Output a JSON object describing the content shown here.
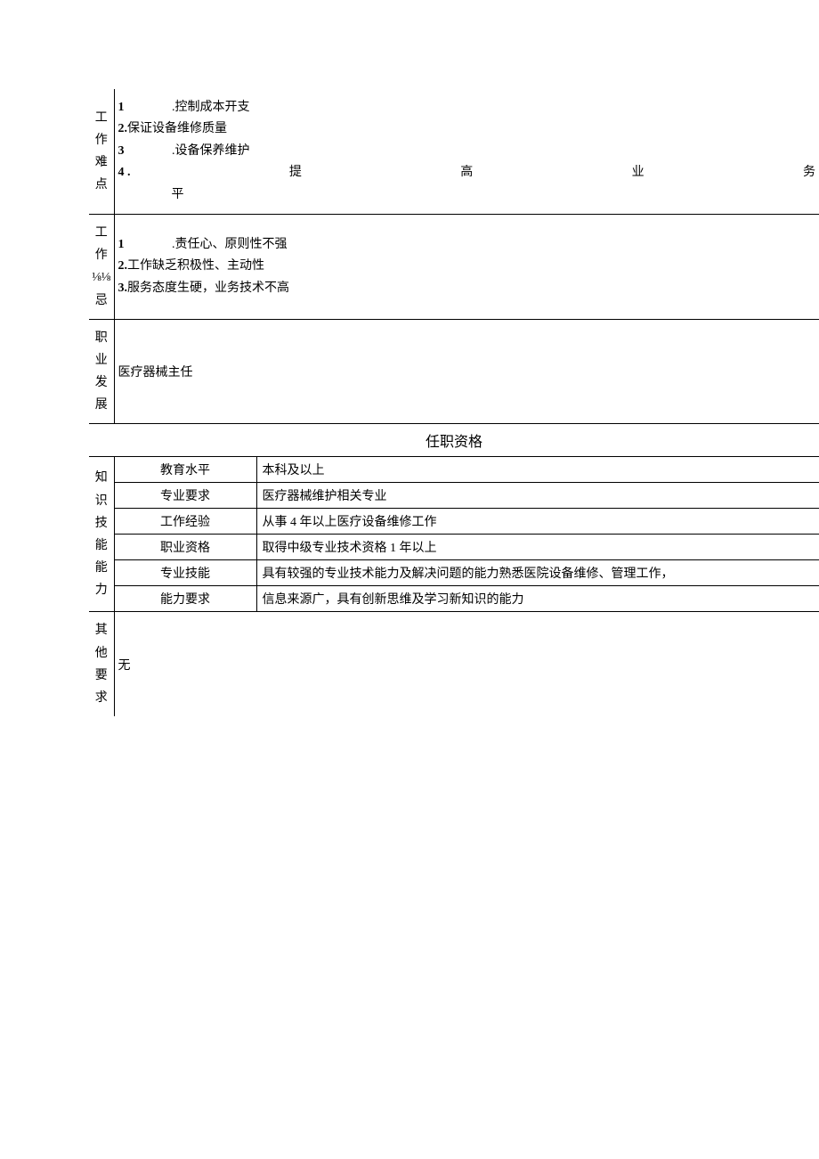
{
  "sections": {
    "difficulties": {
      "label_chars": [
        "工",
        "作",
        "难",
        "点"
      ],
      "items": [
        {
          "num": "1",
          "text": ".控制成本开支",
          "indent": true
        },
        {
          "num": "2.",
          "text": "保证设备维修质量",
          "indent": false
        },
        {
          "num": "3",
          "text": ".设备保养维护",
          "indent": true
        }
      ],
      "item4_num": "4 .",
      "item4_chars": [
        "提",
        "高",
        "业",
        "务"
      ],
      "item4_tail": "平"
    },
    "taboos": {
      "label_chars": [
        "工",
        "作",
        "⅛⅛",
        "忌"
      ],
      "items": [
        {
          "num": "1",
          "text": ".责任心、原则性不强",
          "indent": true
        },
        {
          "num": "2.",
          "text": "工作缺乏积极性、主动性",
          "indent": false
        },
        {
          "num": "3.",
          "text": "服务态度生硬，业务技术不高",
          "indent": false
        }
      ]
    },
    "career": {
      "label_chars": [
        "职",
        "业",
        "发",
        "展"
      ],
      "content": "医疗器械主任"
    },
    "qualifications": {
      "header": "任职资格",
      "knowledge_label_chars": [
        "知",
        "识",
        "技",
        "能",
        "能",
        "力"
      ],
      "rows": [
        {
          "label": "教育水平",
          "value": "本科及以上"
        },
        {
          "label": "专业要求",
          "value": "医疗器械维护相关专业"
        },
        {
          "label": "工作经验",
          "value": "从事 4 年以上医疗设备维修工作"
        },
        {
          "label": "职业资格",
          "value": "取得中级专业技术资格 1 年以上"
        },
        {
          "label": "专业技能",
          "value": "具有较强的专业技术能力及解决问题的能力熟悉医院设备维修、管理工作，"
        },
        {
          "label": "能力要求",
          "value": "信息来源广，具有创新思维及学习新知识的能力"
        }
      ],
      "other_label_chars": [
        "其",
        "他",
        "要",
        "求"
      ],
      "other_value": "无"
    }
  }
}
